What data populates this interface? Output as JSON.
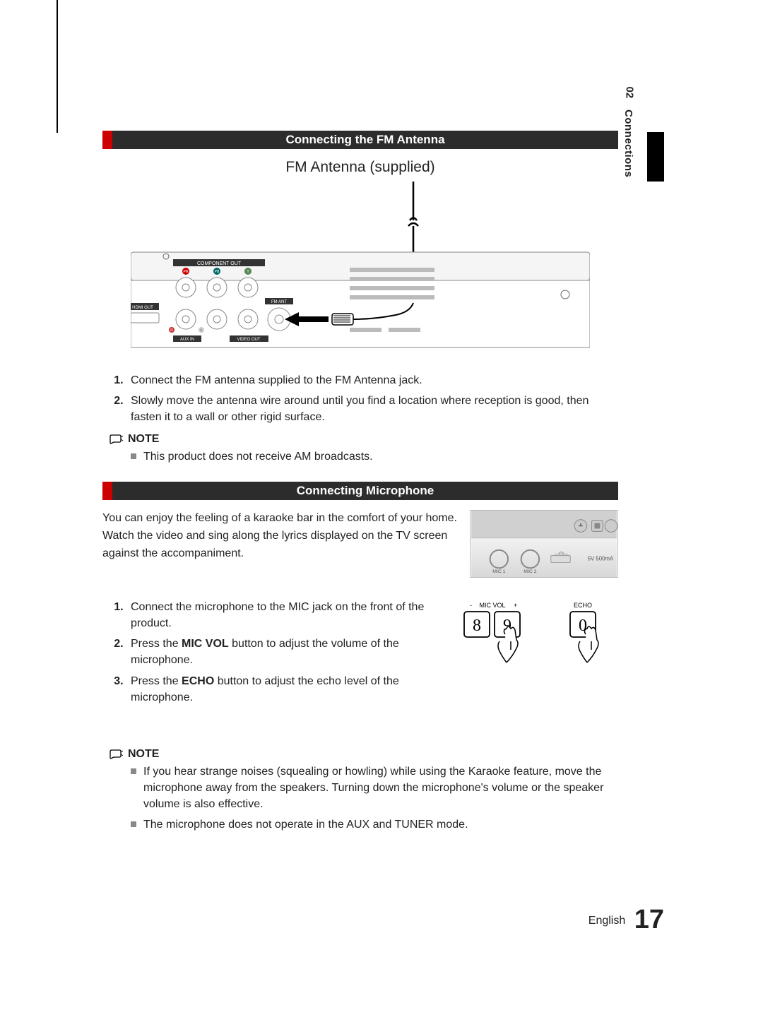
{
  "sidebar": {
    "chapter_num": "02",
    "chapter_label": "Connections"
  },
  "section1": {
    "title": "Connecting the FM Antenna",
    "caption": "FM Antenna (supplied)",
    "diagram_labels": {
      "component_out": "COMPONENT OUT",
      "fm_ant": "FM ANT",
      "hdmi_out": "HDMI OUT",
      "aux_in": "AUX IN",
      "video_out": "VIDEO OUT",
      "pr": "PR",
      "pb": "PB",
      "y": "Y",
      "r": "R",
      "l": "L"
    },
    "steps": [
      "Connect the FM antenna supplied to the FM Antenna jack.",
      "Slowly move the antenna wire around until you find a location where reception is good, then fasten it to a wall or other rigid surface."
    ],
    "note_label": "NOTE",
    "notes": [
      "This product does not receive AM broadcasts."
    ]
  },
  "section2": {
    "title": "Connecting Microphone",
    "intro": [
      "You can enjoy the feeling of a karaoke bar in the comfort of your home.",
      "Watch the video and sing along the lyrics displayed on the TV screen",
      "against the accompaniment."
    ],
    "panel_labels": {
      "mic1": "MIC 1",
      "mic2": "MIC 2",
      "usb": "5V 500mA"
    },
    "remote_labels": {
      "micvol_minus": "-",
      "micvol": "MIC VOL",
      "micvol_plus": "+",
      "echo": "ECHO",
      "btn8": "8",
      "btn9": "9",
      "btn0": "0"
    },
    "steps_text": {
      "s1": "Connect the microphone to the MIC jack on the front of the product.",
      "s2a": "Press the ",
      "s2b": "MIC VOL",
      "s2c": " button to adjust the volume of the microphone.",
      "s3a": "Press the ",
      "s3b": "ECHO",
      "s3c": " button to adjust the echo level of the microphone."
    },
    "note_label": "NOTE",
    "notes": [
      "If you hear strange noises (squealing or howling) while using the Karaoke feature, move the microphone away from the speakers. Turning down the microphone's volume or the speaker volume is also effective.",
      "The microphone does not operate in the AUX and TUNER mode."
    ]
  },
  "footer": {
    "lang": "English",
    "page": "17"
  }
}
